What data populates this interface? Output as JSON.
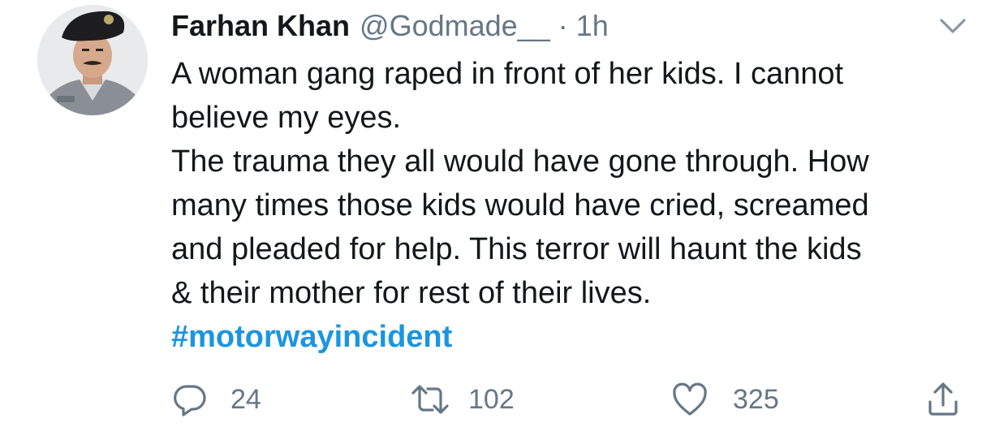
{
  "author": {
    "display_name": "Farhan Khan",
    "handle": "@Godmade__",
    "separator": "·",
    "time": "1h"
  },
  "tweet": {
    "lines": [
      "A woman gang raped in front of her kids. I cannot",
      "believe my eyes.",
      "The trauma they all would have gone through. How",
      "many times those kids would have cried, screamed",
      "and pleaded for help. This terror will haunt the kids",
      "& their mother for rest of their lives."
    ],
    "hashtag": "#motorwayincident"
  },
  "actions": {
    "reply": {
      "icon": "reply-icon",
      "count": "24"
    },
    "retweet": {
      "icon": "retweet-icon",
      "count": "102"
    },
    "like": {
      "icon": "heart-icon",
      "count": "325"
    },
    "share": {
      "icon": "share-icon"
    }
  },
  "menu": {
    "icon": "chevron-down-icon"
  },
  "colors": {
    "text": "#14171a",
    "secondary": "#657786",
    "link": "#1b95e0",
    "background": "#ffffff"
  }
}
